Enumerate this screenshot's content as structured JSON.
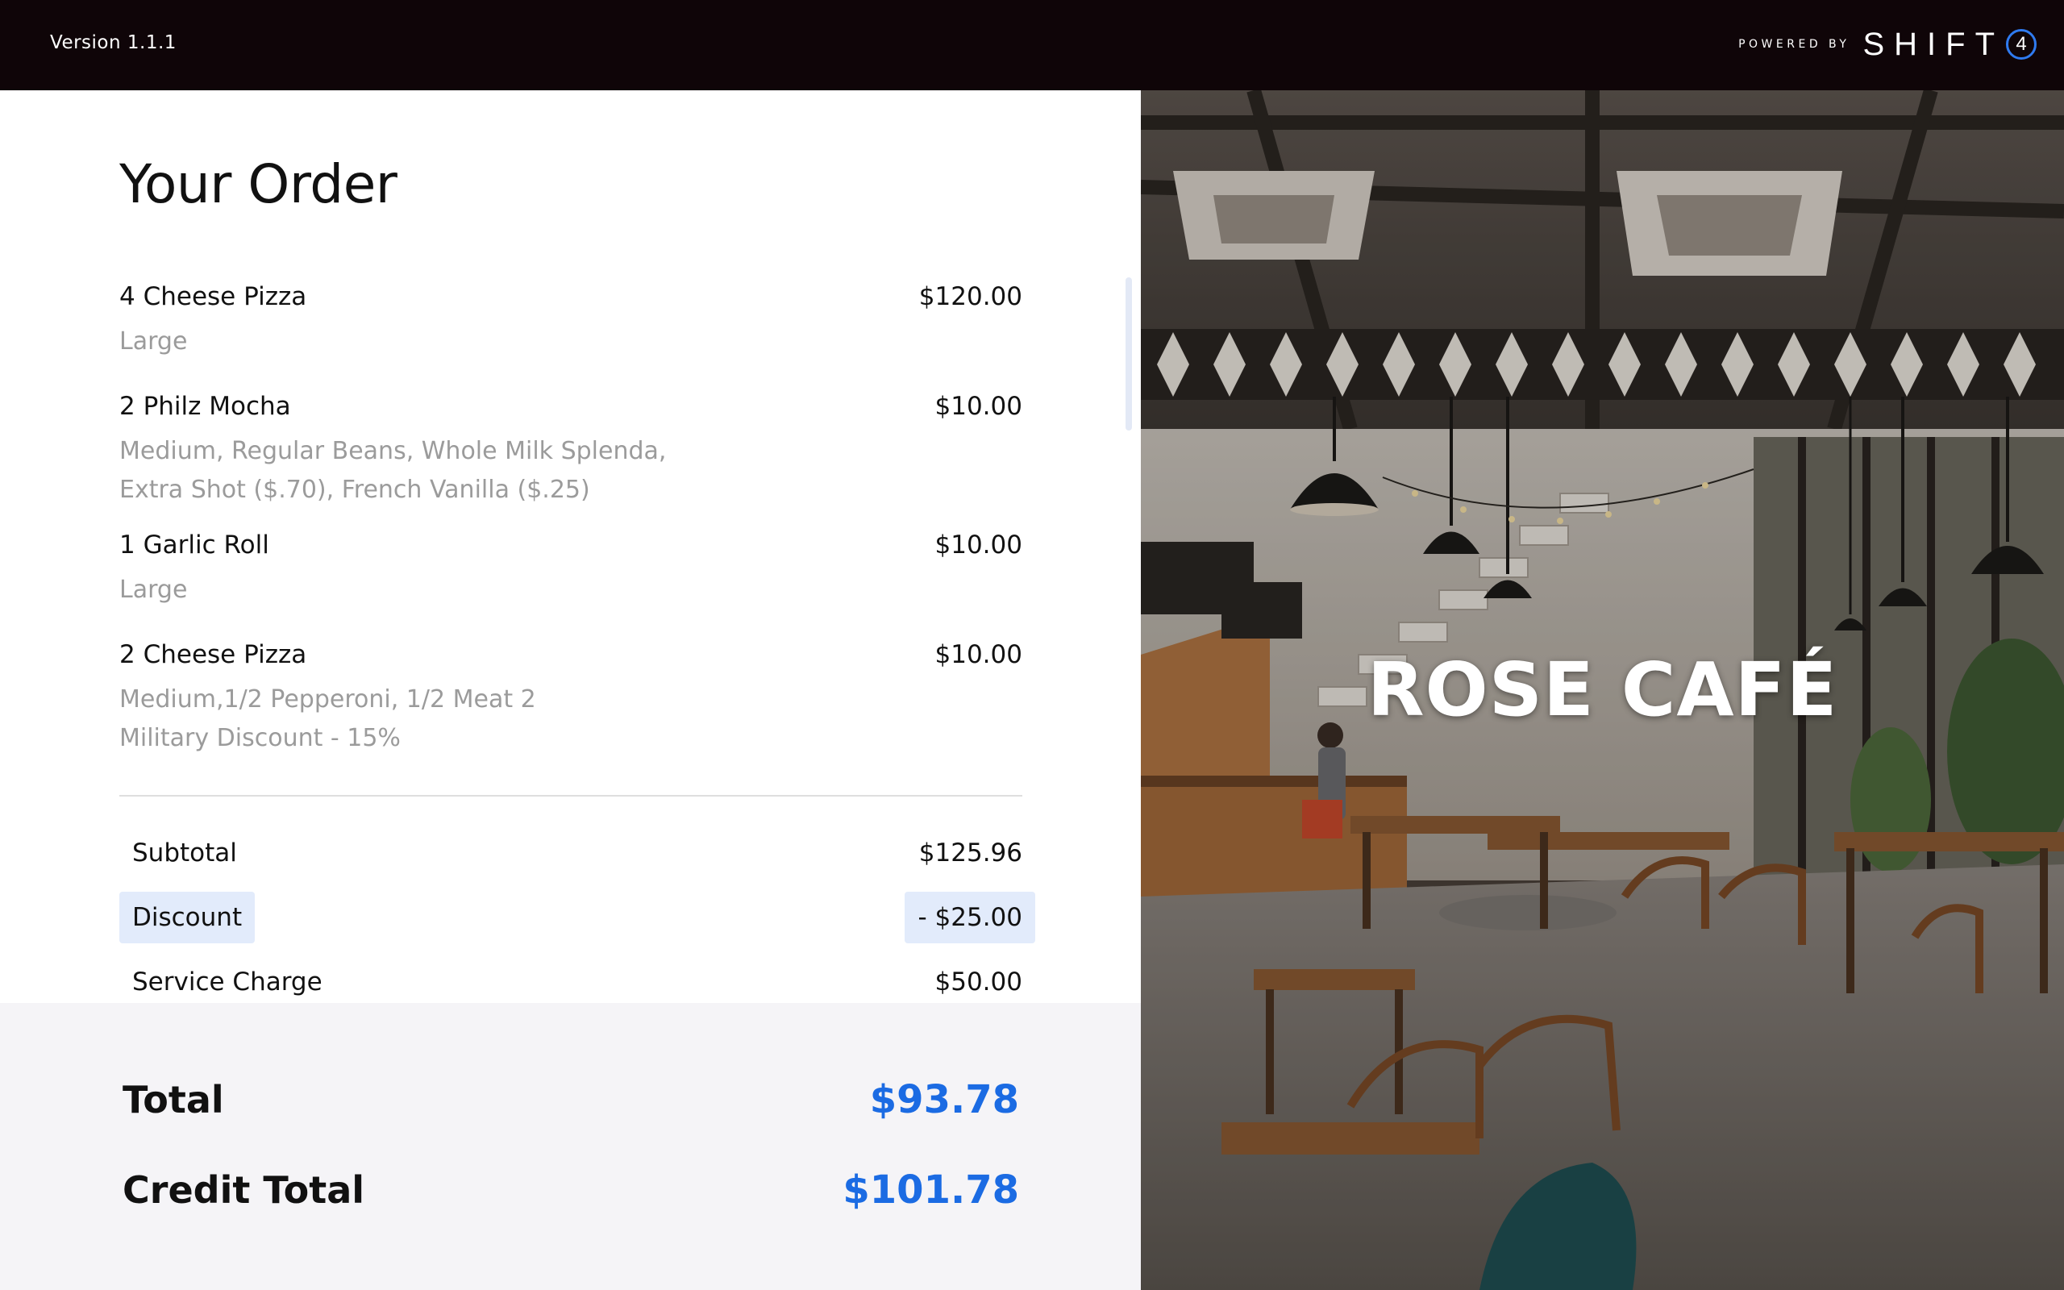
{
  "app": {
    "version": "Version 1.1.1",
    "powered_by": "POWERED BY",
    "brand_text": "SHIFT",
    "brand_number": "4",
    "accent_color": "#1b6be3"
  },
  "order": {
    "title": "Your Order",
    "items": [
      {
        "name": "4 Cheese Pizza",
        "price": "$120.00",
        "mods": [
          "Large"
        ]
      },
      {
        "name": "2 Philz Mocha",
        "price": "$10.00",
        "mods": [
          "Medium, Regular Beans, Whole Milk Splenda,",
          "Extra Shot ($.70), French Vanilla ($.25)"
        ]
      },
      {
        "name": "1 Garlic Roll",
        "price": "$10.00",
        "mods": [
          "Large"
        ]
      },
      {
        "name": "2 Cheese Pizza",
        "price": "$10.00",
        "mods": [
          "Medium,1/2 Pepperoni, 1/2 Meat 2",
          "Military Discount - 15%"
        ]
      }
    ],
    "summary": {
      "subtotal_label": "Subtotal",
      "subtotal_value": "$125.96",
      "discount_label": "Discount",
      "discount_value": "- $25.00",
      "service_label": "Service Charge",
      "service_value": "$50.00"
    },
    "totals": {
      "total_label": "Total",
      "total_value": "$93.78",
      "credit_label": "Credit Total",
      "credit_value": "$101.78"
    }
  },
  "hero": {
    "restaurant_name": "ROSE CAFÉ"
  }
}
